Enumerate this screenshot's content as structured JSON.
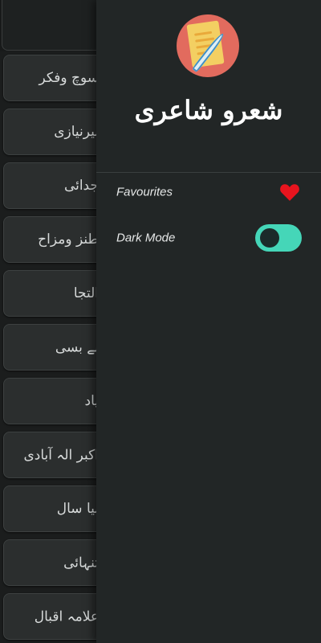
{
  "list": {
    "items": [
      "سوچ وفکر",
      "نیرنیازی",
      "جدائی",
      "طنز ومزاح",
      "التجا",
      "بے بسی",
      "یاد",
      "اکبر الہ آبادی",
      "نیا سال",
      "تنہائی",
      "علامہ اقبال"
    ]
  },
  "drawer": {
    "title": "شعرو شاعری",
    "menu": {
      "favourites_label": "Favourites",
      "favourites_icon": "heart-icon",
      "dark_mode_label": "Dark Mode",
      "dark_mode_on": true
    }
  },
  "colors": {
    "accent": "#45d6b8",
    "heart": "#e8141e",
    "logo_bg": "#e26b5e"
  }
}
